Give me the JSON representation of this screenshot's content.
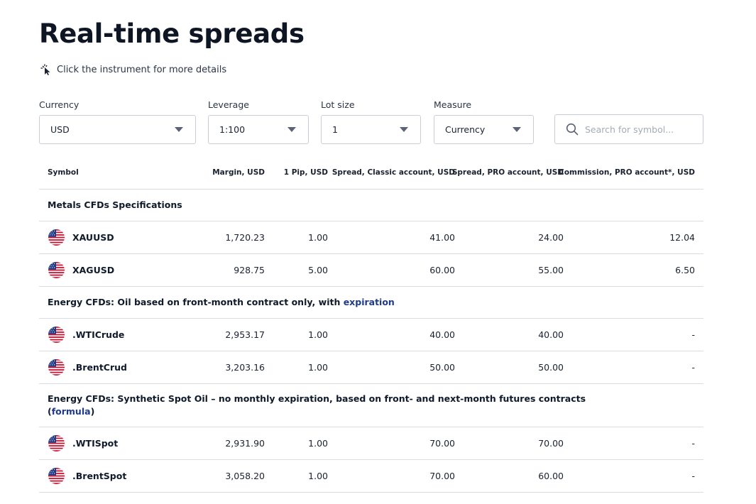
{
  "page": {
    "title": "Real-time spreads",
    "hint": "Click the instrument for more details"
  },
  "filters": {
    "currency": {
      "label": "Currency",
      "value": "USD"
    },
    "leverage": {
      "label": "Leverage",
      "value": "1:100"
    },
    "lot_size": {
      "label": "Lot size",
      "value": "1"
    },
    "measure": {
      "label": "Measure",
      "value": "Currency"
    },
    "search": {
      "placeholder": "Search for symbol..."
    }
  },
  "table": {
    "headers": {
      "symbol": "Symbol",
      "margin": "Margin, USD",
      "pip": "1 Pip, USD",
      "spread_classic": "Spread, Classic account, USD",
      "spread_pro": "Spread, PRO account, USD",
      "commission_pro": "Commission, PRO account*, USD"
    },
    "groups": [
      {
        "title": "Metals CFDs Specifications",
        "rows": [
          {
            "symbol": "XAUUSD",
            "margin": "1,720.23",
            "pip": "1.00",
            "spread_classic": "41.00",
            "spread_pro": "24.00",
            "commission": "12.04"
          },
          {
            "symbol": "XAGUSD",
            "margin": "928.75",
            "pip": "5.00",
            "spread_classic": "60.00",
            "spread_pro": "55.00",
            "commission": "6.50"
          }
        ]
      },
      {
        "title": "Energy CFDs: Oil based on front-month contract only, with ",
        "link": "expiration",
        "rows": [
          {
            "symbol": ".WTICrude",
            "margin": "2,953.17",
            "pip": "1.00",
            "spread_classic": "40.00",
            "spread_pro": "40.00",
            "commission": "-"
          },
          {
            "symbol": ".BrentCrud",
            "margin": "3,203.16",
            "pip": "1.00",
            "spread_classic": "50.00",
            "spread_pro": "50.00",
            "commission": "-"
          }
        ]
      },
      {
        "title_line1": "Energy CFDs: Synthetic Spot Oil – no monthly expiration, based on front- and next-month futures contracts",
        "title_open": "(",
        "link": "formula",
        "title_close": ")",
        "rows": [
          {
            "symbol": ".WTISpot",
            "margin": "2,931.90",
            "pip": "1.00",
            "spread_classic": "70.00",
            "spread_pro": "70.00",
            "commission": "-"
          },
          {
            "symbol": ".BrentSpot",
            "margin": "3,058.20",
            "pip": "1.00",
            "spread_classic": "70.00",
            "spread_pro": "60.00",
            "commission": "-"
          }
        ]
      }
    ]
  },
  "icons": {
    "hint": "pointer-click-icon",
    "search": "search-icon",
    "flag": "us-flag-icon",
    "dropdown": "chevron-down-icon"
  },
  "colors": {
    "link": "#1e3a8a",
    "divider": "#d9dde3",
    "flag_red": "#c8102e",
    "flag_blue": "#1f3c88"
  }
}
